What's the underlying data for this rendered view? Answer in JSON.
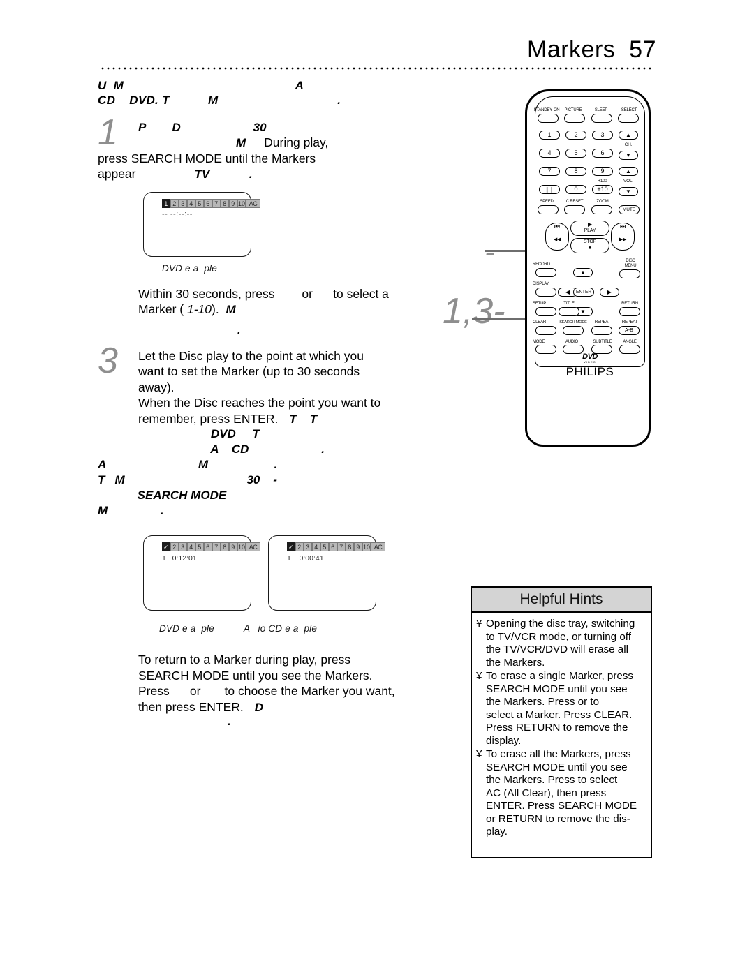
{
  "header": {
    "title": "Markers  57"
  },
  "intro": {
    "line1": "U  M                                                 A",
    "line2": "CD    DVD. T           M                                  ."
  },
  "steps": [
    {
      "number": "1",
      "emph_pre": "P        D                      30",
      "emph_mid": "M",
      "text": "During play,\npress SEARCH MODE until the Markers\nappear",
      "emph_tail": "TV            ."
    },
    {
      "number": "",
      "text": "Within 30 seconds, press        or      to select a\nMarker ( ",
      "marker_range": "1-10",
      "text_tail": ").  ",
      "emph": "M",
      "emph_line2": "."
    },
    {
      "number": "3",
      "text": "Let the Disc play to the point at which you\nwant to set the Marker (up to 30 seconds\naway).\nWhen the Disc reaches the point you want to\nremember, press ENTER.   ",
      "emph_inline": "T    T",
      "emph_lines": [
        "                      DVD     T",
        "                      A    CD                      .",
        "A                            M                    .",
        "T   M                                     30    -",
        "            SEARCH MODE",
        "M                ."
      ]
    }
  ],
  "screens": {
    "screen1": {
      "cells": [
        "1",
        "2",
        "3",
        "4",
        "5",
        "6",
        "7",
        "8",
        "9",
        "10",
        "AC"
      ],
      "selected_index": 0,
      "time": "-- --:--:--",
      "caption": "DVD e a  ple"
    },
    "screen2": {
      "cells": [
        "✓",
        "2",
        "3",
        "4",
        "5",
        "6",
        "7",
        "8",
        "9",
        "10",
        "AC"
      ],
      "selected_index": 0,
      "time": "1   0:12:01",
      "caption": "DVD e a  ple"
    },
    "screen3": {
      "cells": [
        "✓",
        "2",
        "3",
        "4",
        "5",
        "6",
        "7",
        "8",
        "9",
        "10",
        "AC"
      ],
      "selected_index": 0,
      "time": "1    0:00:41",
      "caption": "A   io CD e a  ple"
    }
  },
  "closing": {
    "text": "To return to a Marker during play, press\nSEARCH MODE until you see the Markers.\nPress      or       to choose the Marker you want,\nthen press ENTER.   ",
    "emph": "D",
    "emph_line2": "."
  },
  "callouts": {
    "enter": "-",
    "search_mode": "1,3-"
  },
  "remote": {
    "brand": "PHILIPS",
    "disc_logo": "DVD",
    "disc_logo_sub": "VIDEO",
    "top_row": [
      "STANDBY·ON",
      "PICTURE",
      "SLEEP",
      "SELECT"
    ],
    "numbers": [
      "1",
      "2",
      "3",
      "4",
      "5",
      "6",
      "7",
      "8",
      "9"
    ],
    "pause_row": [
      "❙❙",
      "0",
      "+10"
    ],
    "plus100": "+100",
    "ch_label": "CH.",
    "vol_label": "VOL.",
    "mute": "MUTE",
    "row_speed": [
      "SPEED",
      "C.RESET",
      "ZOOM"
    ],
    "transport": {
      "prev": "⏮",
      "rew": "◀◀",
      "play": "PLAY",
      "next": "⏭",
      "ff": "▶▶",
      "stop": "STOP"
    },
    "record": "RECORD",
    "disc_menu": "DISC\nMENU",
    "display": "DISPLAY",
    "enter": "ENTER",
    "setup": "SETUP",
    "title": "TITLE",
    "return": "RETURN",
    "clear": "CLEAR",
    "search_mode": "SEARCH MODE",
    "repeat": "REPEAT",
    "repeat_ab_label": "REPEAT",
    "repeat_ab": "A-B",
    "mode": "MODE",
    "audio": "AUDIO",
    "subtitle": "SUBTITLE",
    "angle": "ANGLE"
  },
  "hints": {
    "title": "Helpful Hints",
    "bullet": "¥",
    "items": [
      "Opening the disc tray, switching\nto TV/VCR mode, or turning off\nthe TV/VCR/DVD will erase all\nthe Markers.",
      "To erase a single Marker, press\nSEARCH MODE until you see\nthe Markers. Press or      to\nselect a Marker. Press CLEAR.\nPress RETURN to remove the\ndisplay.",
      "To erase all the Markers, press\nSEARCH MODE until you see\nthe Markers. Press to select\nAC (All Clear), then press\nENTER. Press SEARCH MODE\nor RETURN to remove the dis-\nplay."
    ]
  },
  "colors": {
    "accent_gray": "#8e8e8e",
    "hint_header_bg": "#d4d4d4",
    "marker_cell_bg": "#b8b8b8"
  }
}
